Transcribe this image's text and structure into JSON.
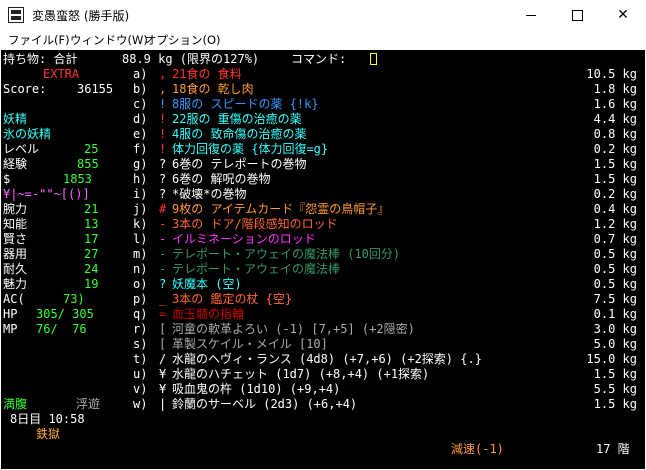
{
  "window": {
    "title": "変愚蛮怒 (勝手版)",
    "icon": "app-icon",
    "controls": {
      "minimize": "minimize-icon",
      "maximize": "maximize-icon",
      "close": "✕"
    }
  },
  "menu": {
    "file": "ファイル(F)",
    "window": "ウィンドウ(W)",
    "options": "オプション(O)"
  },
  "colors": {
    "background": "#000000",
    "white": "#ffffff",
    "red": "#ff3333",
    "dark_red": "#cc0000",
    "green": "#33ff33",
    "cyan": "#33ffff",
    "yellow": "#ffff33",
    "orange": "#ff9933",
    "orange_red": "#ff6633",
    "blue": "#3399ff",
    "magenta": "#ff33ff",
    "pink": "#ff66ff",
    "gray": "#aaaaaa",
    "dark_green": "#339966",
    "bright_orange": "#ffaa33"
  },
  "terminal": {
    "header": {
      "label": "持ち物: 合計",
      "weight": "88.9 kg (限界の127%)",
      "prompt": "コマンド:"
    },
    "sidebar": {
      "extra": "EXTRA",
      "score_label": "Score:",
      "score_value": "36155",
      "race": "妖精",
      "class": "氷の妖精",
      "level_label": "レベル",
      "level_value": "25",
      "exp_label": "経験",
      "exp_value": "855",
      "gold_label": "$",
      "gold_value": "1853",
      "equip_chars": "¥|~=-\"\"~[()]",
      "stats": [
        {
          "label": "腕力",
          "value": "21"
        },
        {
          "label": "知能",
          "value": "13"
        },
        {
          "label": "賢さ",
          "value": "17"
        },
        {
          "label": "器用",
          "value": "27"
        },
        {
          "label": "耐久",
          "value": "24"
        },
        {
          "label": "魅力",
          "value": "19"
        }
      ],
      "ac_label": "AC(",
      "ac_value": "73)",
      "hp_label": "HP",
      "hp_value": "305/ 305",
      "mp_label": "MP",
      "mp_value": "76/  76"
    },
    "items": [
      {
        "key": "a)",
        "sym": ",",
        "name": "21食の 食料",
        "weight": "10.5 kg",
        "sym_color": "#ff3333",
        "name_color": "#ff3333"
      },
      {
        "key": "b)",
        "sym": ",",
        "name": "18食の 乾し肉",
        "weight": "1.8 kg",
        "sym_color": "#ff9933",
        "name_color": "#ff9933"
      },
      {
        "key": "c)",
        "sym": "!",
        "name": "8服の スピードの薬 {!k}",
        "weight": "1.6 kg",
        "sym_color": "#3399ff",
        "name_color": "#3399ff"
      },
      {
        "key": "d)",
        "sym": "!",
        "name": "22服の 重傷の治癒の薬",
        "weight": "4.4 kg",
        "sym_color": "#ff3333",
        "name_color": "#33ffff"
      },
      {
        "key": "e)",
        "sym": "!",
        "name": "4服の 致命傷の治癒の薬",
        "weight": "0.8 kg",
        "sym_color": "#ff3333",
        "name_color": "#33ffff"
      },
      {
        "key": "f)",
        "sym": "!",
        "name": "体力回復の薬 {体力回復=g}",
        "weight": "0.2 kg",
        "sym_color": "#ff3333",
        "name_color": "#33ffff"
      },
      {
        "key": "g)",
        "sym": "?",
        "name": "6巻の テレポートの巻物",
        "weight": "1.5 kg",
        "sym_color": "#ffffff",
        "name_color": "#ffffff"
      },
      {
        "key": "h)",
        "sym": "?",
        "name": "6巻の 解呪の巻物",
        "weight": "1.5 kg",
        "sym_color": "#ffffff",
        "name_color": "#ffffff"
      },
      {
        "key": "i)",
        "sym": "?",
        "name": "*破壊*の巻物",
        "weight": "0.2 kg",
        "sym_color": "#ffffff",
        "name_color": "#ffffff"
      },
      {
        "key": "j)",
        "sym": "#",
        "name": "9枚の アイテムカード『怨霊の鳥帽子』",
        "weight": "0.4 kg",
        "sym_color": "#ff3333",
        "name_color": "#ff9933"
      },
      {
        "key": "k)",
        "sym": "-",
        "name": "3本の ドア/階段感知のロッド",
        "weight": "1.2 kg",
        "sym_color": "#ff3333",
        "name_color": "#ff6633"
      },
      {
        "key": "l)",
        "sym": "-",
        "name": "イルミネーションのロッド",
        "weight": "0.7 kg",
        "sym_color": "#ff33ff",
        "name_color": "#ff33ff"
      },
      {
        "key": "m)",
        "sym": "-",
        "name": "テレポート・アウェイの魔法棒 (10回分)",
        "weight": "0.5 kg",
        "sym_color": "#339966",
        "name_color": "#339966"
      },
      {
        "key": "n)",
        "sym": "-",
        "name": "テレポート・アウェイの魔法棒",
        "weight": "0.5 kg",
        "sym_color": "#339966",
        "name_color": "#339966"
      },
      {
        "key": "o)",
        "sym": "?",
        "name": "妖魔本 (空)",
        "weight": "0.5 kg",
        "sym_color": "#33ffff",
        "name_color": "#33ffff"
      },
      {
        "key": "p)",
        "sym": "_",
        "name": "3本の 鑑定の杖 {空}",
        "weight": "7.5 kg",
        "sym_color": "#ff6633",
        "name_color": "#ff6633"
      },
      {
        "key": "q)",
        "sym": "=",
        "name": "血玉髄の指輪",
        "weight": "0.1 kg",
        "sym_color": "#cc0000",
        "name_color": "#cc0000"
      },
      {
        "key": "r)",
        "sym": "[",
        "name": "河童の軟革よろい (-1) [7,+5] (+2隠密)",
        "weight": "3.0 kg",
        "sym_color": "#aaaaaa",
        "name_color": "#aaaaaa"
      },
      {
        "key": "s)",
        "sym": "[",
        "name": "革製スケイル・メイル [10]",
        "weight": "5.0 kg",
        "sym_color": "#aaaaaa",
        "name_color": "#aaaaaa"
      },
      {
        "key": "t)",
        "sym": "/",
        "name": "水龍のヘヴィ・ランス (4d8) (+7,+6) (+2探索) {.}",
        "weight": "15.0 kg",
        "sym_color": "#ffffff",
        "name_color": "#ffffff"
      },
      {
        "key": "u)",
        "sym": "¥",
        "name": "水龍のハチェット (1d7) (+8,+4) (+1探索)",
        "weight": "1.5 kg",
        "sym_color": "#ffffff",
        "name_color": "#ffffff"
      },
      {
        "key": "v)",
        "sym": "¥",
        "name": "吸血鬼の杵 (1d10) (+9,+4)",
        "weight": "5.5 kg",
        "sym_color": "#ffffff",
        "name_color": "#ffffff"
      },
      {
        "key": "w)",
        "sym": "|",
        "name": "鈴蘭のサーベル (2d3) (+6,+4)",
        "weight": "1.5 kg",
        "sym_color": "#ffffff",
        "name_color": "#ffffff"
      }
    ],
    "status": {
      "hunger": "満腹",
      "levitation": "浮遊",
      "day": "8日目 10:58",
      "location": "鉄獄",
      "speed": "減速(-1)",
      "depth": "17 階"
    }
  }
}
